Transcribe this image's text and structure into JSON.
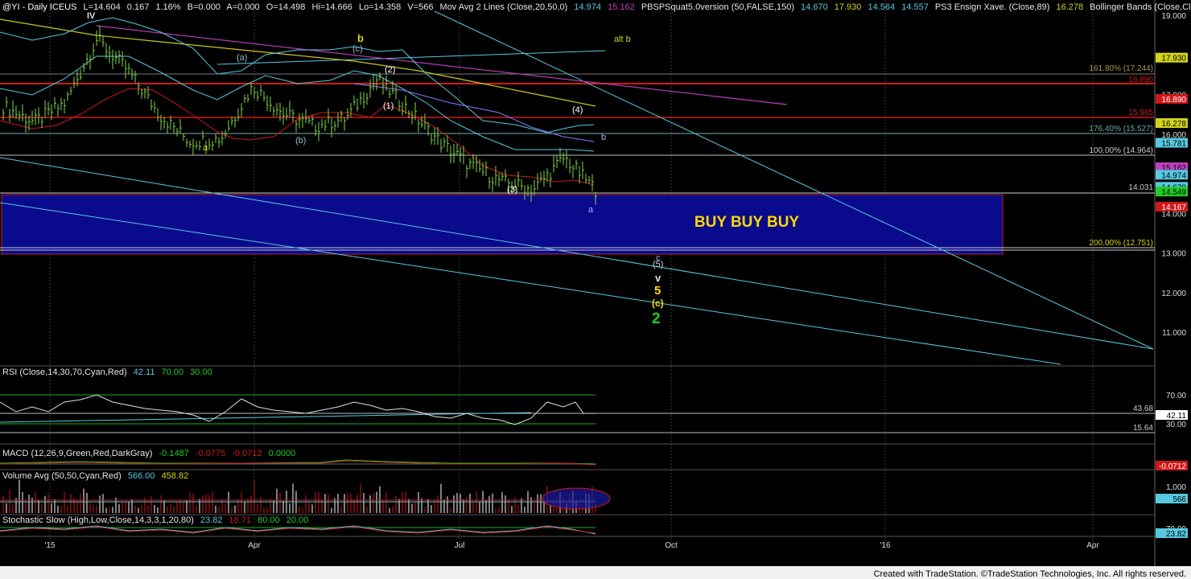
{
  "header": {
    "symbol": "@YI - Daily  ICEUS",
    "last": "L=14.604",
    "change": "0.167",
    "change_pct": "1.16%",
    "bid": "B=0.000",
    "ask": "A=0.000",
    "open": "O=14.498",
    "high": "Hi=14.666",
    "low": "Lo=14.358",
    "volume": "V=566",
    "ma_label": "Mov Avg 2 Lines (Close,20,50,0)",
    "ma_v1": "14.974",
    "ma_v2": "15.162",
    "pbs_label": "PBSPSquat5.0version (50,FALSE,150)",
    "pbs_v1": "14.670",
    "pbs_v2": "17.930",
    "pbs_v3": "14.564",
    "pbs_v4": "14.557",
    "ensign_label": "PS3 Ensign Xave. (Close,89)",
    "ensign_v": "16.278",
    "bb_label": "Bollinger Bands (Close,Clo"
  },
  "panels": {
    "rsi": {
      "label": "RSI (Close,14,30,70,Cyan,Red)",
      "v1": "42.11",
      "v2": "70.00",
      "v3": "30.00"
    },
    "macd": {
      "label": "MACD (12,26,9,Green,Red,DarkGray)",
      "v1": "-0.1487",
      "v2": "-0.0775",
      "v3": "-0.0712",
      "v4": "0.0000"
    },
    "volume": {
      "label": "Volume Avg (50,50,Cyan,Red)",
      "v1": "566.00",
      "v2": "458.82"
    },
    "stoch": {
      "label": "Stochastic Slow (High,Low,Close,14,3,3,1,20,80)",
      "v1": "23.82",
      "v2": "18.71",
      "v3": "80.00",
      "v4": "20.00"
    }
  },
  "price_axis": {
    "ticks": [
      "19.000",
      "18.000",
      "17.000",
      "16.000",
      "15.000",
      "14.000",
      "13.000",
      "12.000",
      "11.000"
    ],
    "tags": {
      "t17930": "17.930",
      "t16890": "16.890",
      "t16278": "16.278",
      "t15781": "15.781",
      "t15162": "15.162",
      "t14974": "14.974",
      "t14670": "14.670",
      "t14549": "14.549",
      "t14167": "14.167"
    }
  },
  "rsi_axis": {
    "ticks": [
      "70.00",
      "30.00"
    ],
    "tag": "42.11"
  },
  "macd_axis": {
    "tag": "-0.0712"
  },
  "vol_axis": {
    "tick": "1,000",
    "tag": "566"
  },
  "stoch_axis": {
    "tick": "70.00",
    "tag": "23.82"
  },
  "date_axis": [
    "'15",
    "Apr",
    "Jul",
    "Oct",
    "'16",
    "Apr"
  ],
  "fib_labels": {
    "f1618": "161.80% (17.244)",
    "f1764": "176.40% (15.527)",
    "f100": "100.00% (14.964)",
    "f200": "200.00% (12.751)",
    "level_14031": "14.031",
    "level_15965": "15.965",
    "level_16890": "16.890"
  },
  "rsi_levels": {
    "l1": "43.68",
    "l2": "15.64"
  },
  "buy_box": "BUY BUY BUY",
  "wave_labels": {
    "IV": "IV",
    "a1": "a",
    "paren_a": "(a)",
    "paren_b": "(b)",
    "b_yellow": "b",
    "paren_c": "(c)",
    "p1": "(1)",
    "p2": "(2)",
    "p3": "(3)",
    "p4": "(4)",
    "b_right": "b",
    "a_right": "a",
    "alt_b": "alt b",
    "c_low": "c",
    "p5": "(5)",
    "v": "v",
    "five": "5",
    "pc_low": "(c)",
    "two": "2"
  },
  "footer": "Created with TradeStation. ©TradeStation Technologies, Inc. All rights reserved.",
  "colors": {
    "bg": "#000000",
    "bars": "#7fd94a",
    "cyan": "#58c8e0",
    "yellow": "#d4d41a",
    "magenta": "#c040c0",
    "red": "#d01818",
    "buy_box": "#0a0a8c",
    "buy_text": "#ffd800",
    "green_wave": "#22cc22"
  },
  "chart_data": {
    "type": "line",
    "title": "@YI - Daily ICEUS",
    "ylim": [
      10.6,
      19.4
    ],
    "series": [
      {
        "name": "Close",
        "x": [
          "2014-12-12",
          "2014-12-26",
          "2015-01-09",
          "2015-01-23",
          "2015-02-06",
          "2015-02-20",
          "2015-03-06",
          "2015-03-20",
          "2015-04-03",
          "2015-04-17",
          "2015-05-01",
          "2015-05-15",
          "2015-05-29",
          "2015-06-12",
          "2015-06-26",
          "2015-07-10",
          "2015-07-24",
          "2015-08-07",
          "2015-08-21",
          "2015-08-28"
        ],
        "values": [
          16.7,
          16.3,
          16.8,
          18.4,
          17.6,
          16.5,
          15.8,
          15.9,
          17.2,
          16.5,
          16.2,
          16.4,
          17.4,
          16.6,
          15.8,
          15.2,
          14.8,
          14.6,
          15.4,
          14.6
        ]
      }
    ]
  }
}
